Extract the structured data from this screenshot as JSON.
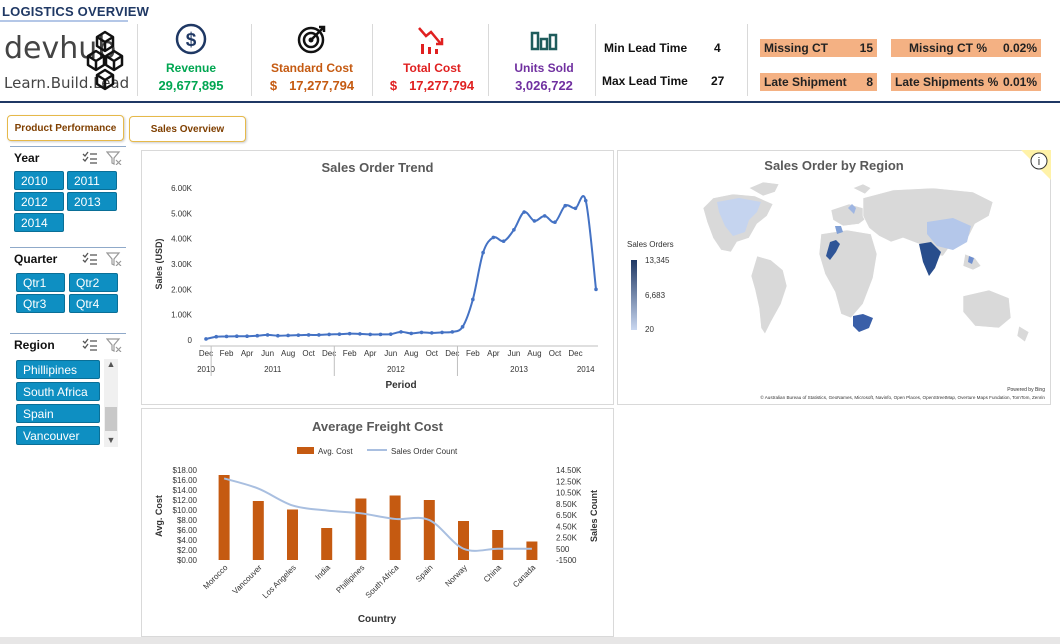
{
  "header": {
    "title": "LOGISTICS OVERVIEW"
  },
  "logo": {
    "text": "devhub",
    "tagline": "Learn.Build.Lead"
  },
  "kpis": [
    {
      "label": "Revenue",
      "value": "29,677,895",
      "icon": "dollar-circle-icon",
      "color": "#00a651",
      "prefix": ""
    },
    {
      "label": "Standard Cost",
      "value": "17,277,794",
      "icon": "target-icon",
      "color": "#c55a11",
      "prefix": "$"
    },
    {
      "label": "Total Cost",
      "value": "17,277,794",
      "icon": "down-trend-icon",
      "color": "#e02020",
      "prefix": "$"
    },
    {
      "label": "Units Sold",
      "value": "3,026,722",
      "icon": "bar-chart-icon",
      "color": "#7030a0",
      "prefix": ""
    }
  ],
  "lead": {
    "min_label": "Min Lead Time",
    "min_value": "4",
    "max_label": "Max Lead Time",
    "max_value": "27"
  },
  "badges": {
    "missing_ct_label": "Missing CT",
    "missing_ct_value": "15",
    "missing_ct_pct_label": "Missing CT %",
    "missing_ct_pct_value": "0.02%",
    "late_label": "Late Shipment",
    "late_value": "8",
    "late_pct_label": "Late Shipments %",
    "late_pct_value": "0.01%"
  },
  "nav": {
    "product": "Product Performance",
    "sales": "Sales Overview"
  },
  "slicers": {
    "year": {
      "label": "Year",
      "items": [
        "2010",
        "2011",
        "2012",
        "2013",
        "2014"
      ]
    },
    "quarter": {
      "label": "Quarter",
      "items": [
        "Qtr1",
        "Qtr2",
        "Qtr3",
        "Qtr4"
      ]
    },
    "region": {
      "label": "Region",
      "items": [
        "Phillipines",
        "South Africa",
        "Spain",
        "Vancouver"
      ]
    }
  },
  "trend_chart": {
    "title": "Sales Order Trend",
    "ylabel": "Sales (USD)",
    "xlabel": "Period",
    "yticks": [
      "0",
      "1.00K",
      "2.00K",
      "3.00K",
      "4.00K",
      "5.00K",
      "6.00K"
    ],
    "months": [
      "Dec",
      "Feb",
      "Apr",
      "Jun",
      "Aug",
      "Oct",
      "Dec",
      "Feb",
      "Apr",
      "Jun",
      "Aug",
      "Oct",
      "Dec",
      "Feb",
      "Apr",
      "Jun",
      "Aug",
      "Oct",
      "Dec"
    ],
    "years": [
      "2010",
      "2011",
      "2012",
      "2013",
      "2014"
    ]
  },
  "chart_data": [
    {
      "type": "line",
      "title": "Sales Order Trend",
      "xlabel": "Period",
      "ylabel": "Sales (USD)",
      "ylim": [
        0,
        6000
      ],
      "x": [
        "2010-12",
        "2011-01",
        "2011-02",
        "2011-03",
        "2011-04",
        "2011-05",
        "2011-06",
        "2011-07",
        "2011-08",
        "2011-09",
        "2011-10",
        "2011-11",
        "2011-12",
        "2012-01",
        "2012-02",
        "2012-03",
        "2012-04",
        "2012-05",
        "2012-06",
        "2012-07",
        "2012-08",
        "2012-09",
        "2012-10",
        "2012-11",
        "2012-12",
        "2013-01",
        "2013-02",
        "2013-03",
        "2013-04",
        "2013-05",
        "2013-06",
        "2013-07",
        "2013-08",
        "2013-09",
        "2013-10",
        "2013-11",
        "2013-12",
        "2014-01"
      ],
      "values": [
        40,
        130,
        140,
        150,
        150,
        170,
        200,
        170,
        180,
        190,
        200,
        200,
        220,
        230,
        250,
        240,
        220,
        220,
        230,
        320,
        260,
        300,
        280,
        300,
        320,
        520,
        1600,
        3450,
        4050,
        3900,
        4350,
        5050,
        4700,
        4900,
        4650,
        5300,
        5200,
        5500,
        2000
      ]
    },
    {
      "type": "bar",
      "title": "Average Freight Cost",
      "xlabel": "Country",
      "ylabel": "Avg. Cost",
      "y2label": "Sales Count",
      "categories": [
        "Morocco",
        "Vancouver",
        "Los Angeles",
        "India",
        "Phillipines",
        "South Africa",
        "Spain",
        "Norway",
        "China",
        "Canada"
      ],
      "ylim": [
        0,
        18
      ],
      "y2lim": [
        -1500,
        14500
      ],
      "series": [
        {
          "name": "Avg. Cost",
          "type": "bar",
          "color": "#c55a11",
          "values": [
            17.0,
            11.8,
            10.1,
            6.4,
            12.3,
            12.9,
            12.0,
            7.8,
            6.0,
            3.7
          ]
        },
        {
          "name": "Sales Order Count",
          "type": "line",
          "color": "#a9bfe0",
          "values": [
            13000,
            11200,
            8200,
            7300,
            6800,
            5800,
            5600,
            500,
            500,
            500
          ]
        }
      ]
    }
  ],
  "freight_chart": {
    "title": "Average Freight Cost",
    "legend_bar": "Avg. Cost",
    "legend_line": "Sales Order Count",
    "ylabel": "Avg. Cost",
    "y2label": "Sales Count",
    "xlabel": "Country",
    "yticks": [
      "$0.00",
      "$2.00",
      "$4.00",
      "$6.00",
      "$8.00",
      "$10.00",
      "$12.00",
      "$14.00",
      "$16.00",
      "$18.00"
    ],
    "y2ticks": [
      "-1500",
      "500",
      "2.50K",
      "4.50K",
      "6.50K",
      "8.50K",
      "10.50K",
      "12.50K",
      "14.50K"
    ]
  },
  "map": {
    "title": "Sales Order by Region",
    "legend_title": "Sales Orders",
    "legend_max": "13,345",
    "legend_mid": "6,683",
    "legend_min": "20",
    "powered": "Powered by Bing",
    "attribution": "© Australian Bureau of Statistics, GeoNames, Microsoft, Navinfo, Open Places, OpenStreetMap, Overture Maps Fundation, TomTom, Zenrin",
    "info_glyph": "i"
  }
}
